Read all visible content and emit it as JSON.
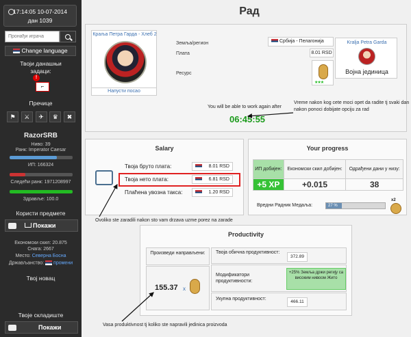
{
  "sidebar": {
    "clock": "17:14:05 10-07-2014",
    "day": "дан 1039",
    "search_placeholder": "Пронађи играча",
    "change_language": "Change language",
    "tasks_label": "Твоји данашњи задаци:",
    "shortcuts_label": "Пречице",
    "username": "RazorSRB",
    "level": "Ниво: 39",
    "rank": "Ранк: Imperator Caesar",
    "xp": "ИП: 166324",
    "next_rank": "Следећи ранк: 1971208997",
    "health": "Здравље: 100.0",
    "items_label": "Користи предмете",
    "show_label": "Покажи",
    "econ_skill": "Економски скил: 20.875",
    "strength": "Снага: 2667",
    "place_label": "Место:",
    "place_value": "Северна Босна",
    "citizenship_label": "Држављанство:",
    "citizenship_value": "промени",
    "money_label": "Твој новац",
    "storage_label": "Твоје складиште",
    "show_label_2": "Покажи",
    "health_pct": 100,
    "xp_pct": 75,
    "rank_pct": 25
  },
  "page": {
    "title": "Рад"
  },
  "job": {
    "company_name": "Краља Петра Гарда - Хлеб 2",
    "leave_label": "Напусти посао",
    "region_label": "Земља/регион",
    "region_value": "Србија -  Пелагонија",
    "wage_label": "Плата",
    "wage_value": "8.01 RSD",
    "resource_label": "Ресурс",
    "unit_name": "Kralja Petra Garda",
    "unit_label": "Војна јединица",
    "work_again_msg": "You will be able to work again after",
    "countdown": "06:45:55",
    "note": "Vreme nakon kog cete moci opet da radite tj svaki dan nakon ponoci dobijate opciju za rad"
  },
  "salary": {
    "title": "Salary",
    "gross_label": "Твоја бруто плата:",
    "gross_value": "8.01 RSD",
    "net_label": "Твоја нето плата:",
    "net_value": "6.81 RSD",
    "tax_label": "Плаћена увозна такса:",
    "tax_value": "1.20 RSD",
    "annotation": "Ovoliko ste zaradili nakon sto vam drzava uzme porez na zarade"
  },
  "progress": {
    "title": "Your progress",
    "xp_header": "ИП добијен:",
    "econ_header": "Економски скил добијен:",
    "days_header": "Одрађени дани у низу:",
    "xp_value": "+5 XP",
    "econ_value": "+0.015",
    "days_value": "38",
    "medal_label": "Вредни Радник Медаља:",
    "medal_pct_label": "27 %",
    "medal_pct": 27,
    "medal_count": "x2"
  },
  "productivity": {
    "title": "Productivity",
    "produced_label": "Произведи направљени:",
    "produced_value": "155.37",
    "produced_x": "x",
    "base_label": "Твоја обична продуктивност:",
    "base_value": "372.89",
    "mod_label": "Модификатори продуктивности:",
    "mod_value": "+25% Земља држи регију са високим нивоом Жито",
    "total_label": "Укупна продуктивност:",
    "total_value": "466.11",
    "annotation": "Vasa produktivnost tj koliko ste napravili jedinica proizvoda"
  }
}
